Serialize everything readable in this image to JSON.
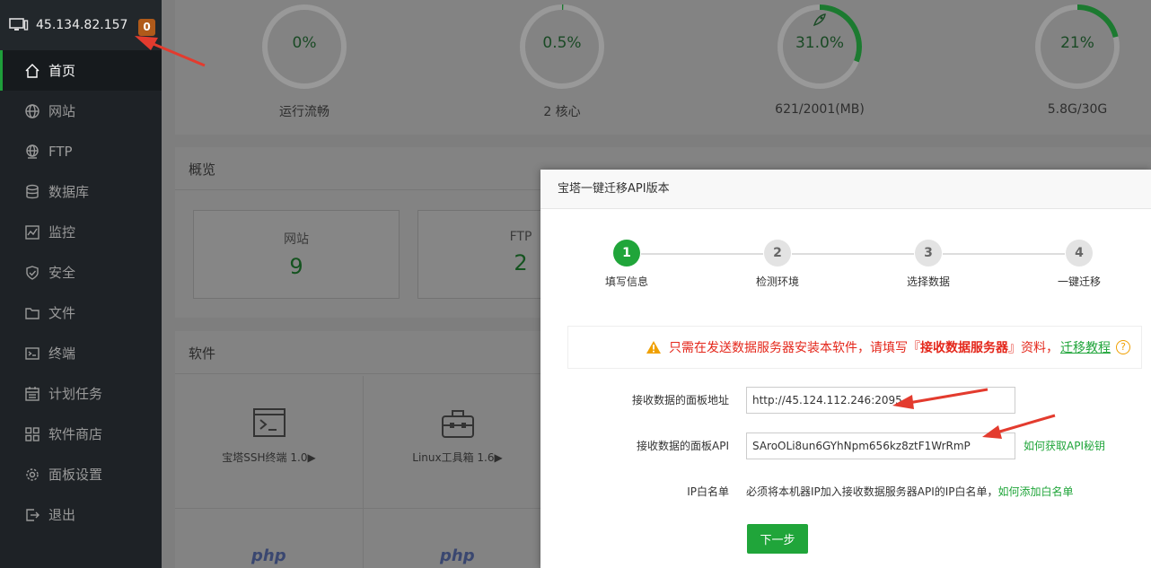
{
  "header": {
    "server_ip": "45.134.82.157",
    "badge_count": "0"
  },
  "sidebar": {
    "items": [
      {
        "label": "首页",
        "icon": "home-icon",
        "active": true
      },
      {
        "label": "网站",
        "icon": "globe-icon"
      },
      {
        "label": "FTP",
        "icon": "ftp-globe-icon"
      },
      {
        "label": "数据库",
        "icon": "database-icon"
      },
      {
        "label": "监控",
        "icon": "monitor-icon"
      },
      {
        "label": "安全",
        "icon": "shield-icon"
      },
      {
        "label": "文件",
        "icon": "folder-icon"
      },
      {
        "label": "终端",
        "icon": "terminal-icon"
      },
      {
        "label": "计划任务",
        "icon": "calendar-icon"
      },
      {
        "label": "软件商店",
        "icon": "grid-icon"
      },
      {
        "label": "面板设置",
        "icon": "gear-icon"
      },
      {
        "label": "退出",
        "icon": "logout-icon"
      }
    ]
  },
  "gauges": [
    {
      "value": "0%",
      "fraction": 0,
      "caption": "运行流畅"
    },
    {
      "value": "0.5%",
      "fraction": 0.005,
      "caption": "2 核心"
    },
    {
      "value": "31.0%",
      "fraction": 0.31,
      "caption": "621/2001(MB)",
      "icon": "rocket-icon"
    },
    {
      "value": "21%",
      "fraction": 0.21,
      "caption": "5.8G/30G"
    }
  ],
  "overview": {
    "title": "概览",
    "boxes": [
      {
        "label": "网站",
        "value": "9"
      },
      {
        "label": "FTP",
        "value": "2"
      }
    ]
  },
  "software": {
    "title": "软件",
    "items": [
      {
        "name": "宝塔SSH终端 1.0▶",
        "icon": "terminal-window-icon"
      },
      {
        "name": "Linux工具箱 1.6▶",
        "icon": "toolbox-icon"
      }
    ],
    "php_logo": "php"
  },
  "dialog": {
    "title": "宝塔一键迁移API版本",
    "steps": [
      {
        "num": "1",
        "label": "填写信息",
        "active": true
      },
      {
        "num": "2",
        "label": "检测环境"
      },
      {
        "num": "3",
        "label": "选择数据"
      },
      {
        "num": "4",
        "label": "一键迁移"
      }
    ],
    "notice": {
      "text_before": "只需在发送数据服务器安装本软件，请填写『",
      "bold": "接收数据服务器",
      "text_after": "』资料，",
      "link": "迁移教程",
      "help": "?"
    },
    "form": {
      "url_label": "接收数据的面板地址",
      "url_value": "http://45.124.112.246:2095",
      "api_label": "接收数据的面板API",
      "api_value": "SAroOLi8un6GYhNpm656kz8ztF1WrRmP",
      "api_link": "如何获取API秘钥",
      "ip_label": "IP白名单",
      "ip_text": "必须将本机器IP加入接收数据服务器API的IP白名单，",
      "ip_link": "如何添加白名单"
    },
    "next_label": "下一步"
  },
  "colors": {
    "accent": "#20a53a",
    "warning": "#e4271b",
    "sidebar_bg": "#1e2226",
    "badge": "#b05a1a"
  }
}
